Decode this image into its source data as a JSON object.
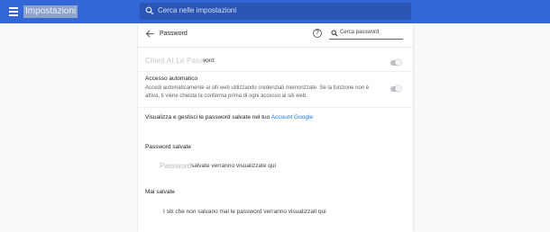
{
  "topbar": {
    "title": "Impostazioni",
    "search_placeholder": "Cerca nelle impostazioni",
    "color": "#3367d6"
  },
  "header": {
    "title": "Password",
    "search_placeholder": "Cerca password",
    "help_glyph": "?"
  },
  "offer_save": {
    "blurred_text": "Chied At Le Passin",
    "suffix": "vord",
    "enabled": false
  },
  "auto_signin": {
    "title": "Accesso automatico",
    "description": "Accedi automaticamente ai siti web utilizzando credenziali memorizzate. Se la funzione non è attiva, ti viene chiesta la conferma prima di ogni accesso ai siti web.",
    "enabled": false
  },
  "manage": {
    "text": "Visualizza e gestisci le password salvate nel tuo",
    "link": "Account Google"
  },
  "saved": {
    "title": "Password salvate",
    "empty_word": "Password",
    "empty_rest": "salvate verranno visualizzate qui"
  },
  "never_saved": {
    "title": "Mai salvate",
    "empty_text": "I siti che non salvano mai le password verranno visualizzati qui"
  },
  "icons": [
    "menu-icon",
    "search-icon",
    "back-arrow-icon",
    "help-icon",
    "search-icon"
  ]
}
